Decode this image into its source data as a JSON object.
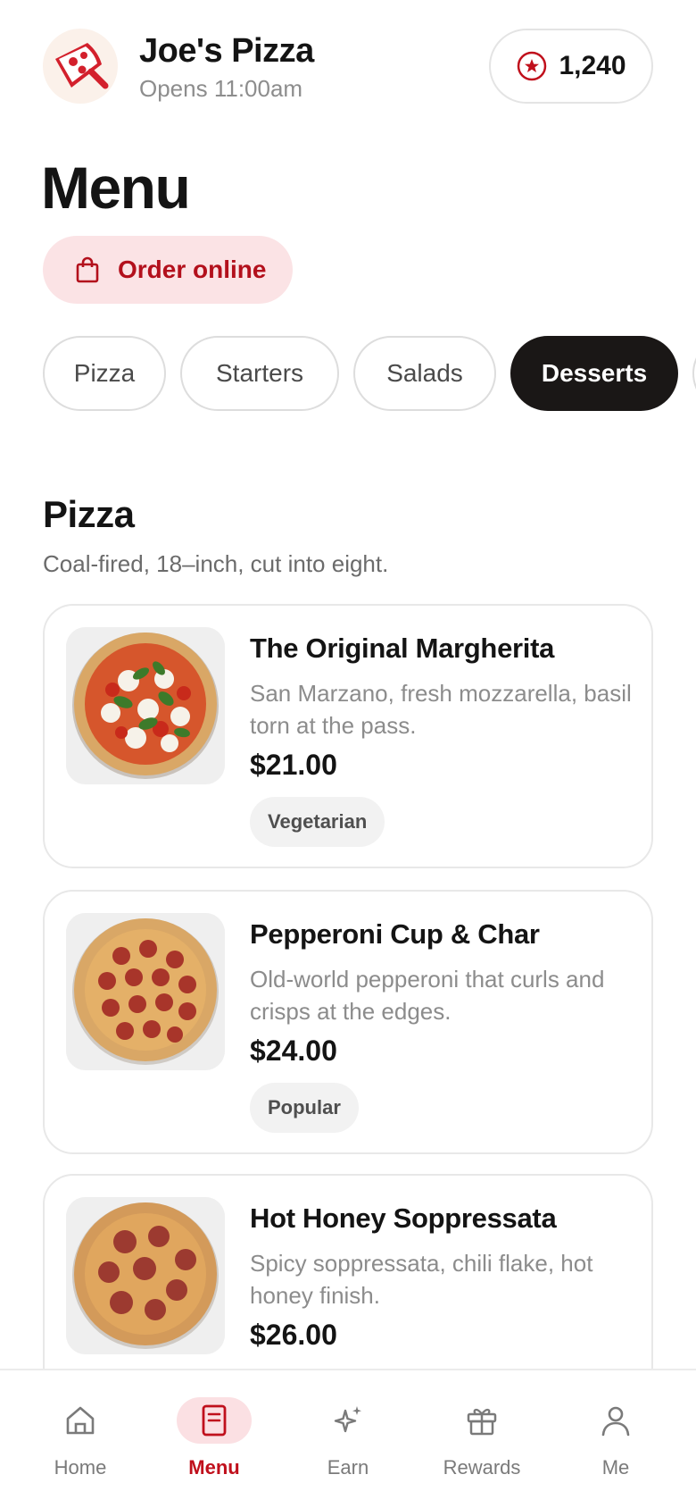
{
  "header": {
    "restaurant_name": "Joe's Pizza",
    "hours": "Opens 11:00am",
    "logo_icon": "pizza-slice-icon",
    "points": "1,240",
    "points_icon": "star-badge-icon"
  },
  "page": {
    "title": "Menu",
    "order_label": "Order online",
    "order_icon": "shopping-bag-icon"
  },
  "categories": [
    {
      "label": "Pizza",
      "active": false
    },
    {
      "label": "Starters",
      "active": false
    },
    {
      "label": "Salads",
      "active": false
    },
    {
      "label": "Desserts",
      "active": true
    }
  ],
  "section": {
    "title": "Pizza",
    "description": "Coal-fired, 18–inch, cut into eight."
  },
  "items": [
    {
      "name": "The Original Margherita",
      "description": "San Marzano, fresh mozzarella, basil torn at the pass.",
      "price": "$21.00",
      "tag": "Vegetarian",
      "image": "margherita-pizza"
    },
    {
      "name": "Pepperoni Cup & Char",
      "description": "Old-world pepperoni that curls and crisps at the edges.",
      "price": "$24.00",
      "tag": "Popular",
      "image": "pepperoni-pizza"
    },
    {
      "name": "Hot Honey Soppressata",
      "description": "Spicy soppressata, chili flake, hot honey finish.",
      "price": "$26.00",
      "tag": "",
      "image": "soppressata-pizza"
    }
  ],
  "bottom_nav": {
    "items": [
      {
        "label": "Home",
        "icon": "home-icon",
        "active": false
      },
      {
        "label": "Menu",
        "icon": "menu-book-icon",
        "active": true
      },
      {
        "label": "Earn",
        "icon": "sparkle-icon",
        "active": false
      },
      {
        "label": "Rewards",
        "icon": "gift-icon",
        "active": false
      },
      {
        "label": "Me",
        "icon": "person-icon",
        "active": false
      }
    ]
  },
  "colors": {
    "accent": "#c0101c",
    "accent_soft": "#fbe3e5",
    "dark_chip": "#1a1716"
  }
}
